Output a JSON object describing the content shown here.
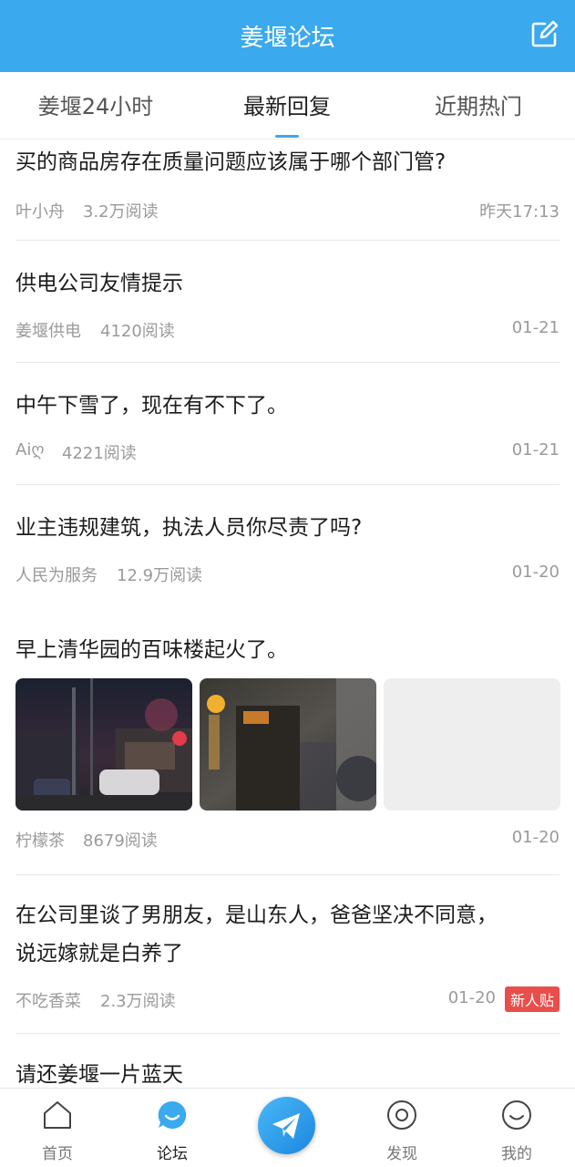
{
  "header": {
    "title": "姜堰论坛",
    "compose_icon": "edit-icon"
  },
  "tabs": [
    {
      "label": "姜堰24小时",
      "active": false
    },
    {
      "label": "最新回复",
      "active": true
    },
    {
      "label": "近期热门",
      "active": false
    }
  ],
  "posts": [
    {
      "title": "买的商品房存在质量问题应该属于哪个部门管?",
      "author": "叶小舟",
      "reads": "3.2万阅读",
      "time": "昨天17:13"
    },
    {
      "title": "供电公司友情提示",
      "author": "姜堰供电",
      "reads": "4120阅读",
      "time": "01-21"
    },
    {
      "title": "中午下雪了，现在有不下了。",
      "author": "Aiღ",
      "reads": "4221阅读",
      "time": "01-21"
    },
    {
      "title": "业主违规建筑，执法人员你尽责了吗?",
      "author": "人民为服务",
      "reads": "12.9万阅读",
      "time": "01-20"
    },
    {
      "title": "早上清华园的百味楼起火了。",
      "author": "柠檬茶",
      "reads": "8679阅读",
      "time": "01-20"
    },
    {
      "title_line1": "在公司里谈了男朋友，是山东人，爸爸坚决不同意，",
      "title_line2": "说远嫁就是白养了",
      "author": "不吃香菜",
      "reads": "2.3万阅读",
      "time": "01-20",
      "badge": "新人贴"
    },
    {
      "title": "请还姜堰一片蓝天"
    }
  ],
  "bottom_nav": [
    {
      "label": "首页",
      "icon": "home-icon",
      "active": false
    },
    {
      "label": "论坛",
      "icon": "forum-chat-icon",
      "active": true
    },
    {
      "label": "",
      "icon": "paper-plane-icon",
      "active": false
    },
    {
      "label": "发现",
      "icon": "discover-icon",
      "active": false
    },
    {
      "label": "我的",
      "icon": "smile-face-icon",
      "active": false
    }
  ],
  "colors": {
    "primary": "#3aa9ee",
    "badge": "#ea4e4a",
    "meta_text": "#9a9a9a"
  }
}
